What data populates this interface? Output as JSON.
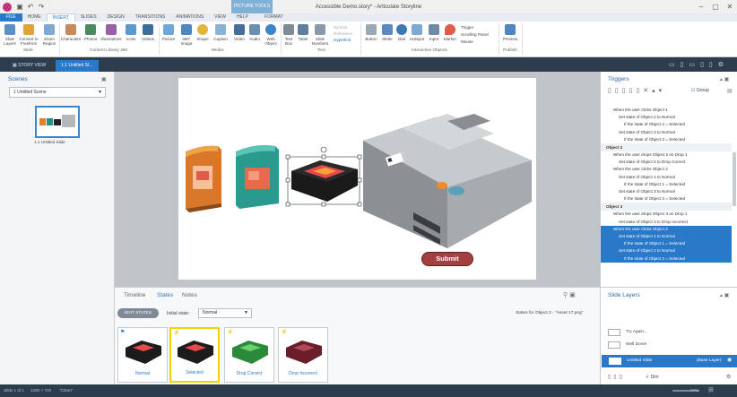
{
  "window": {
    "title": "Accessible Demo.story* - Articulate Storyline",
    "context_tab": "PICTURE TOOLS"
  },
  "tabs": [
    "FILE",
    "HOME",
    "INSERT",
    "SLIDES",
    "DESIGN",
    "TRANSITIONS",
    "ANIMATIONS",
    "VIEW",
    "HELP",
    "FORMAT"
  ],
  "ribbon": {
    "buttons": [
      "Slide Layers",
      "Convert to Freeform",
      "Zoom Region",
      "Characters",
      "Photos",
      "Illustrations",
      "Icons",
      "Videos",
      "Picture",
      "360° Image",
      "Shape",
      "Caption",
      "Video",
      "Audio",
      "Web Object",
      "Text Box",
      "Table",
      "Slide Numbers",
      "Button",
      "Slider",
      "Dial",
      "Hotspot",
      "Input",
      "Marker",
      "Preview"
    ],
    "small": [
      "Symbol",
      "Reference",
      "Hyperlink",
      "Trigger",
      "Scrolling Panel",
      "Mouse"
    ],
    "groups": [
      "Slide",
      "Content Library 360",
      "Media",
      "Text",
      "Interactive Objects",
      "Publish"
    ]
  },
  "scene_tabs": {
    "story_view": "STORY VIEW",
    "current": "1.1 Untitled Sl..."
  },
  "scenes": {
    "title": "Scenes",
    "dropdown": "1 Untitled Scene",
    "thumb_label": "1.1 Untitled Slide"
  },
  "slide": {
    "submit_label": "Submit"
  },
  "bottom": {
    "tabs": [
      "Timeline",
      "States",
      "Notes"
    ],
    "edit_states": "EDIT STATES",
    "initial_state_label": "Initial state:",
    "initial_state_value": "Normal",
    "states_for": "States for Object 3 - \"Asset 17.png\"",
    "states": [
      "Normal",
      "Selected",
      "Drop Correct",
      "Drop Incorrect"
    ]
  },
  "triggers": {
    "title": "Triggers",
    "group_label": "Group",
    "rows": [
      {
        "t": "When the user clicks Object 1",
        "i": 0
      },
      {
        "t": "Set state of Object 2 to Normal",
        "i": 1
      },
      {
        "t": "If the state of Object 2 = Selected",
        "i": 2
      },
      {
        "t": "Set state of Object 3 to Normal",
        "i": 1
      },
      {
        "t": "If the state of Object 3 = Selected",
        "i": 2
      },
      {
        "t": "Object 2",
        "i": -1
      },
      {
        "t": "When the user drops Object 2 on Drop 1",
        "i": 0
      },
      {
        "t": "Set state of Object 2 to Drop Correct",
        "i": 1
      },
      {
        "t": "When the user clicks Object 2",
        "i": 0
      },
      {
        "t": "Set state of Object 1 to Normal",
        "i": 1
      },
      {
        "t": "If the state of Object 1 = Selected",
        "i": 2
      },
      {
        "t": "Set state of Object 3 to Normal",
        "i": 1
      },
      {
        "t": "If the state of Object 3 = Selected",
        "i": 2
      },
      {
        "t": "Object 3",
        "i": -1
      },
      {
        "t": "When the user drops Object 3 on Drop 1",
        "i": 0
      },
      {
        "t": "Set state of Object 3 to Drop Incorrect",
        "i": 1
      },
      {
        "t": "When the user clicks Object 3",
        "i": 0,
        "s": 1
      },
      {
        "t": "Set state of Object 1 to Normal",
        "i": 1,
        "s": 1
      },
      {
        "t": "If the state of Object 1 = Selected",
        "i": 2,
        "s": 1
      },
      {
        "t": "Set state of Object 2 to Normal",
        "i": 1,
        "s": 1
      },
      {
        "t": "If the state of Object 2 = Selected",
        "i": 2,
        "s": 1
      }
    ]
  },
  "layers": {
    "title": "Slide Layers",
    "items": [
      "Try Again...",
      "Well Done!"
    ],
    "base": "Untitled Slide",
    "base_note": "(Base Layer)",
    "dim": "Dim"
  },
  "status": {
    "slide": "Slide 1 of 1",
    "size": "1280 × 720",
    "theme": "\"Clean\"",
    "zoom": "77%"
  }
}
